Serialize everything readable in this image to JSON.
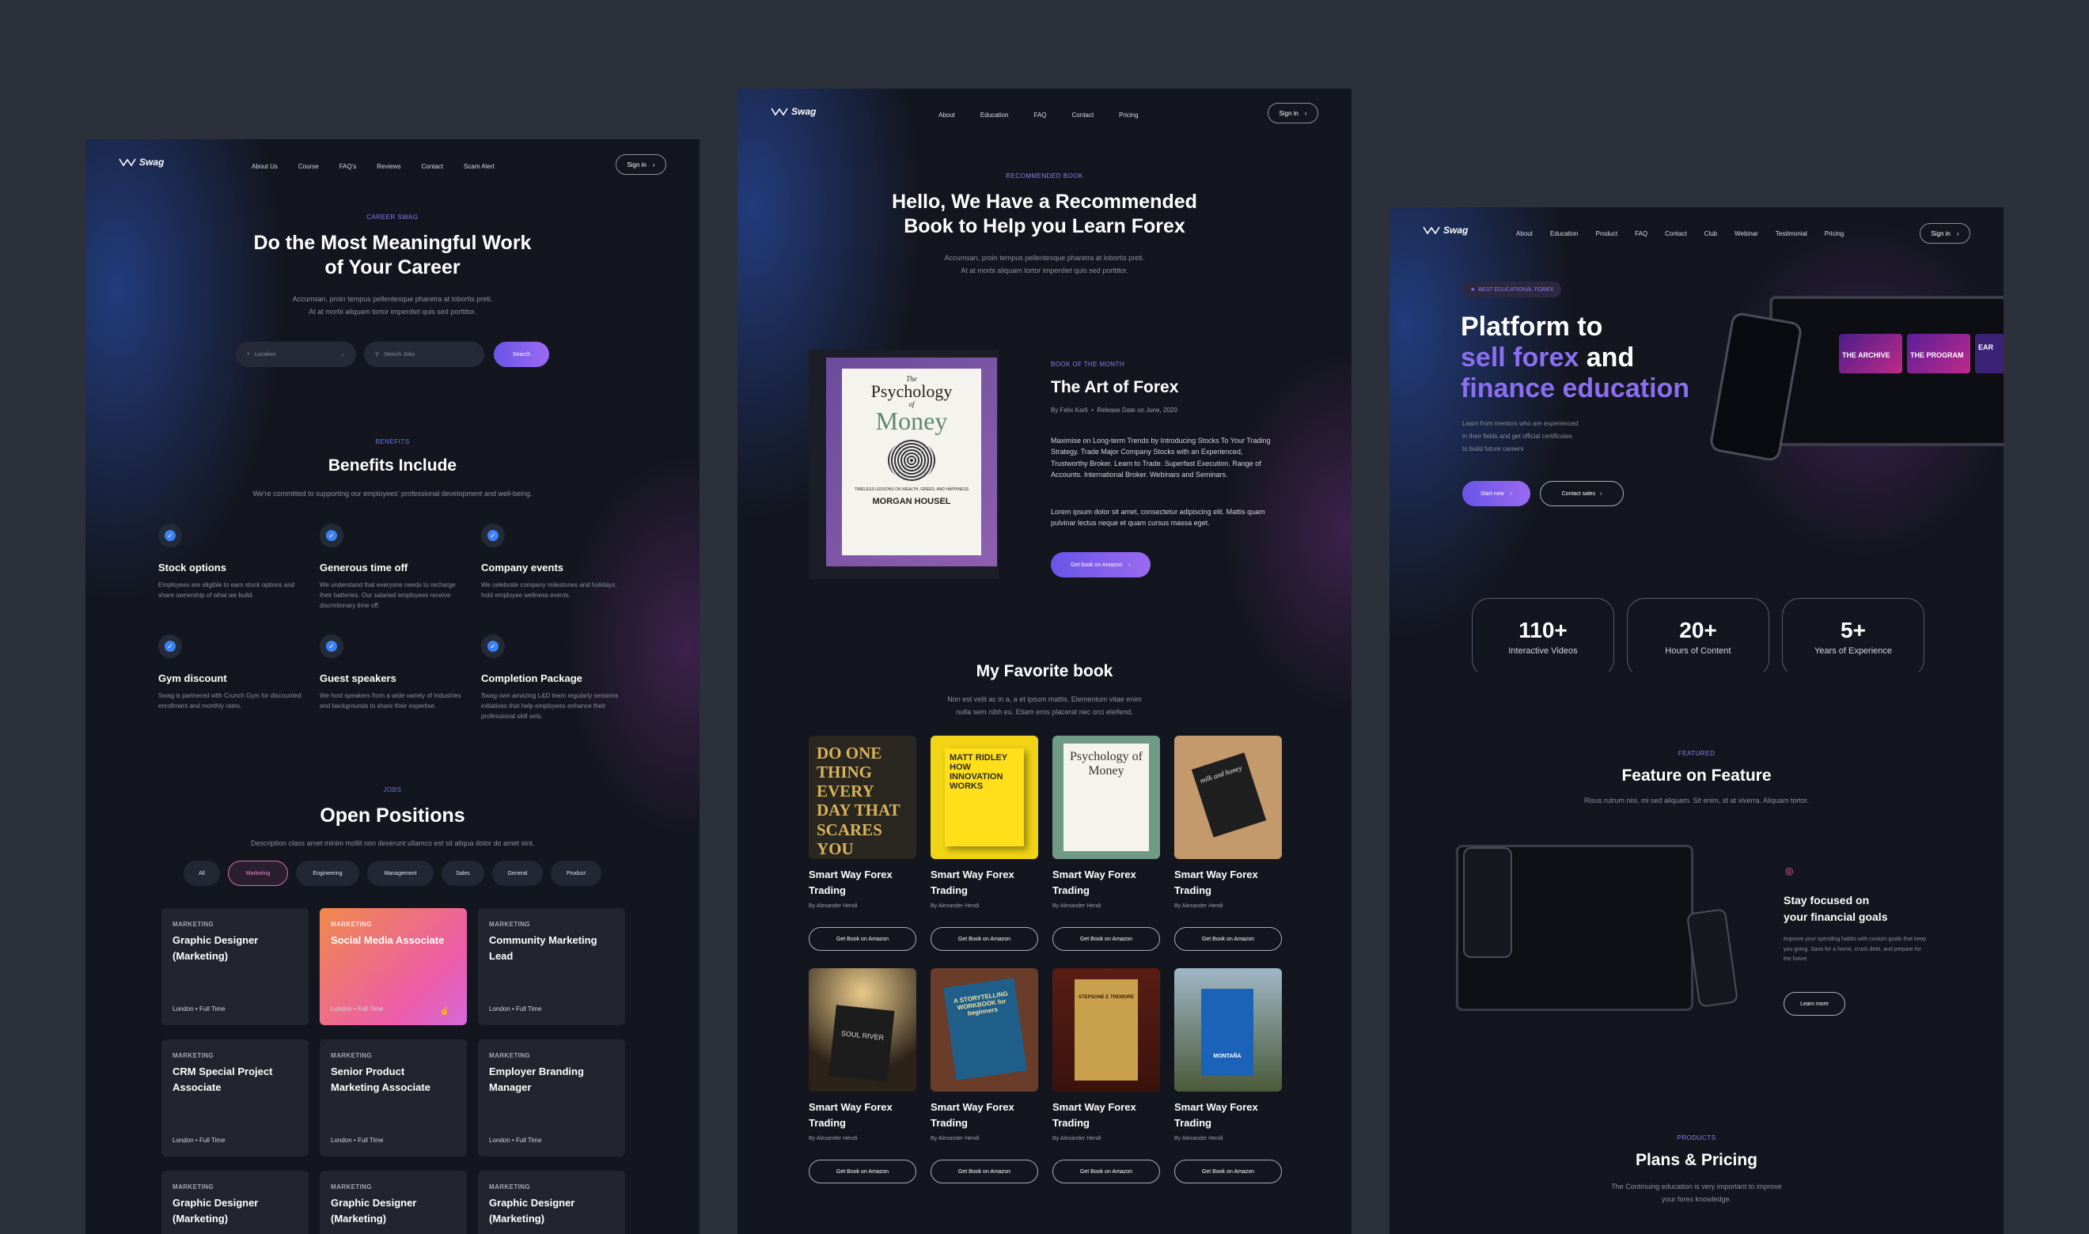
{
  "career": {
    "nav": {
      "brand": "Swag",
      "links": [
        "About Us",
        "Course",
        "FAQ's",
        "Reviews",
        "Contact",
        "Scam Alert"
      ],
      "signin": "Sign in"
    },
    "hero": {
      "eyebrow": "CAREER SWAG",
      "title_line1": "Do the Most Meaningful Work",
      "title_line2": "of Your Career",
      "desc_line1": "Accumsan, proin tempus pellentesque pharetra at lobortis preti.",
      "desc_line2": "At at morbi aliquam tortor imperdiet quis sed porttitor."
    },
    "search": {
      "location_placeholder": "Location",
      "jobs_placeholder": "Search Jobs",
      "button": "Search"
    },
    "benefits": {
      "eyebrow": "BENEFITS",
      "title": "Benefits Include",
      "desc": "We're committed to supporting our employees' professional development and well-being.",
      "items": [
        {
          "title": "Stock options",
          "desc": "Employees are eligible to earn stock options and share ownership of what we build."
        },
        {
          "title": "Generous time off",
          "desc": "We understand that everyone needs to recharge their batteries. Our salaried employees receive discretionary time off."
        },
        {
          "title": "Company events",
          "desc": "We celebrate company milestones and holidays, hold employee wellness events."
        },
        {
          "title": "Gym discount",
          "desc": "Swag is partnered with Crunch Gym for discounted enrollment and monthly rates."
        },
        {
          "title": "Guest speakers",
          "desc": "We host speakers from a wide variety of industries and backgrounds to share their expertise."
        },
        {
          "title": "Completion Package",
          "desc": "Swag own amazing L&D team regularly sessions initiatives that help employees enhance their professional skill sets."
        }
      ]
    },
    "jobs": {
      "eyebrow": "JOBS",
      "title": "Open Positions",
      "desc": "Description class amet minim mollit non deserunt ullamco est sit aliqua dolor do amet sint.",
      "filters": [
        "All",
        "Marketing",
        "Engineering",
        "Management",
        "Sales",
        "General",
        "Product"
      ],
      "items": [
        {
          "cat": "MARKETING",
          "title": "Graphic Designer (Marketing)",
          "loc": "London",
          "type": "Full Time"
        },
        {
          "cat": "MARKETING",
          "title": "Social Media Associate",
          "loc": "London",
          "type": "Full Time"
        },
        {
          "cat": "MARKETING",
          "title": "Community Marketing Lead",
          "loc": "London",
          "type": "Full Time"
        },
        {
          "cat": "MARKETING",
          "title": "CRM Special Project Associate",
          "loc": "London",
          "type": "Full Time"
        },
        {
          "cat": "MARKETING",
          "title": "Senior Product Marketing Associate",
          "loc": "London",
          "type": "Full Time"
        },
        {
          "cat": "MARKETING",
          "title": "Employer Branding Manager",
          "loc": "London",
          "type": "Full Time"
        },
        {
          "cat": "MARKETING",
          "title": "Graphic Designer (Marketing)",
          "loc": "",
          "type": ""
        },
        {
          "cat": "MARKETING",
          "title": "Graphic Designer (Marketing)",
          "loc": "",
          "type": ""
        },
        {
          "cat": "MARKETING",
          "title": "Graphic Designer (Marketing)",
          "loc": "",
          "type": ""
        }
      ]
    }
  },
  "book": {
    "nav": {
      "brand": "Swag",
      "links": [
        "About",
        "Education",
        "FAQ",
        "Contact",
        "Pricing"
      ],
      "signin": "Sign in"
    },
    "hero": {
      "eyebrow": "RECOMMENDED BOOK",
      "title_line1": "Hello, We Have a Recommended",
      "title_line2": "Book to Help you Learn Forex",
      "desc_line1": "Accumsan, proin tempus pellentesque pharetra at lobortis preti.",
      "desc_line2": "At at morbi aliquam tortor imperdiet quis sed porttitor."
    },
    "cover": {
      "the": "The",
      "title1": "Psychology",
      "of": "of",
      "title2": "Money",
      "tagline": "TIMELESS LESSONS ON WEALTH, GREED, AND HAPPINESS",
      "author": "MORGAN HOUSEL"
    },
    "feature": {
      "eyebrow": "BOOK OF THE MONTH",
      "title": "The Art of Forex",
      "author": "By Felix Karli",
      "release": "Release Date on June, 2020",
      "p1": "Maximise on Long-term Trends by Introducing Stocks To Your Trading Strategy. Trade Major Company Stocks with an Experienced, Trustworthy Broker. Learn to Trade. Superfast Execution. Range of Accounts. International Broker. Webinars and Seminars.",
      "p2": "Lorem ipsum dolor sit amet, consectetur adipiscing elit. Mattis quam pulvinar lectus neque et quam cursus massa eget.",
      "button": "Get book on Amazon"
    },
    "favorites": {
      "title": "My Favorite book",
      "desc_line1": "Non est velit ac in a, a et ipsum mattis. Elementum vitae enim",
      "desc_line2": "nulla sem nibh eu. Etiam eros placerat nec orci eleifend.",
      "items": [
        {
          "title": "Smart Way Forex Trading",
          "author": "By Alexander Hendi",
          "button": "Get Book on Amazon",
          "cover_text": "DO ONE THING EVERY DAY THAT SCARES YOU"
        },
        {
          "title": "Smart Way Forex Trading",
          "author": "By Alexander Hendi",
          "button": "Get Book on Amazon",
          "cover_text": "MATT RIDLEY HOW INNOVATION WORKS"
        },
        {
          "title": "Smart Way Forex Trading",
          "author": "By Alexander Hendi",
          "button": "Get Book on Amazon",
          "cover_text": "Psychology of Money"
        },
        {
          "title": "Smart Way Forex Trading",
          "author": "By Alexander Hendi",
          "button": "Get Book on Amazon",
          "cover_text": "milk and honey"
        },
        {
          "title": "Smart Way Forex Trading",
          "author": "By Alexander Hendi",
          "button": "Get Book on Amazon",
          "cover_text": "SOUL RIVER"
        },
        {
          "title": "Smart Way Forex Trading",
          "author": "By Alexander Hendi",
          "button": "Get Book on Amazon",
          "cover_text": "A STORYTELLING WORKBOOK for beginners"
        },
        {
          "title": "Smart Way Forex Trading",
          "author": "By Alexander Hendi",
          "button": "Get Book on Amazon",
          "cover_text": "STEPSONE E TREMORE"
        },
        {
          "title": "Smart Way Forex Trading",
          "author": "By Alexander Hendi",
          "button": "Get Book on Amazon",
          "cover_text": "MONTAÑA"
        }
      ]
    }
  },
  "platform": {
    "nav": {
      "brand": "Swag",
      "links": [
        "About",
        "Education",
        "Product",
        "FAQ",
        "Contact",
        "Club",
        "Webinar",
        "Testimonial",
        "Pricing"
      ],
      "signin": "Sign in"
    },
    "hero": {
      "badge": "BEST EDUCATIONAL FOREX",
      "title_line1": "Platform to",
      "title_sell": "sell forex",
      "title_and": "and",
      "title_line3": "finance education",
      "desc_line1": "Learn from mentors who are experienced",
      "desc_line2": "in their fields and get official certificates",
      "desc_line3": "to build future careers",
      "start": "Start now",
      "contact": "Contact sales"
    },
    "mock": {
      "tab_archive": "THE ARCHIVE",
      "tab_program": "THE PROGRAM",
      "badge": "EAR"
    },
    "stats": [
      {
        "n": "110+",
        "l": "Interactive Videos"
      },
      {
        "n": "20+",
        "l": "Hours of Content"
      },
      {
        "n": "5+",
        "l": "Years of Experience"
      }
    ],
    "featured": {
      "eyebrow": "FEATURED",
      "title": "Feature on Feature",
      "desc": "Risus rutrum nisi, mi sed aliquam. Sit enim, id at viverra. Aliquam tortor.",
      "card_title_line1": "Stay focused on",
      "card_title_line2": "your financial goals",
      "card_desc": "Improve your spending habits with custom goals that keep you going. Save for a home, crush debt, and prepare for the future",
      "button": "Learn more"
    },
    "products": {
      "eyebrow": "PRODUCTS",
      "title": "Plans & Pricing",
      "desc_line1": "The Continuing education is very important to improve",
      "desc_line2": "your forex knowledge."
    }
  }
}
